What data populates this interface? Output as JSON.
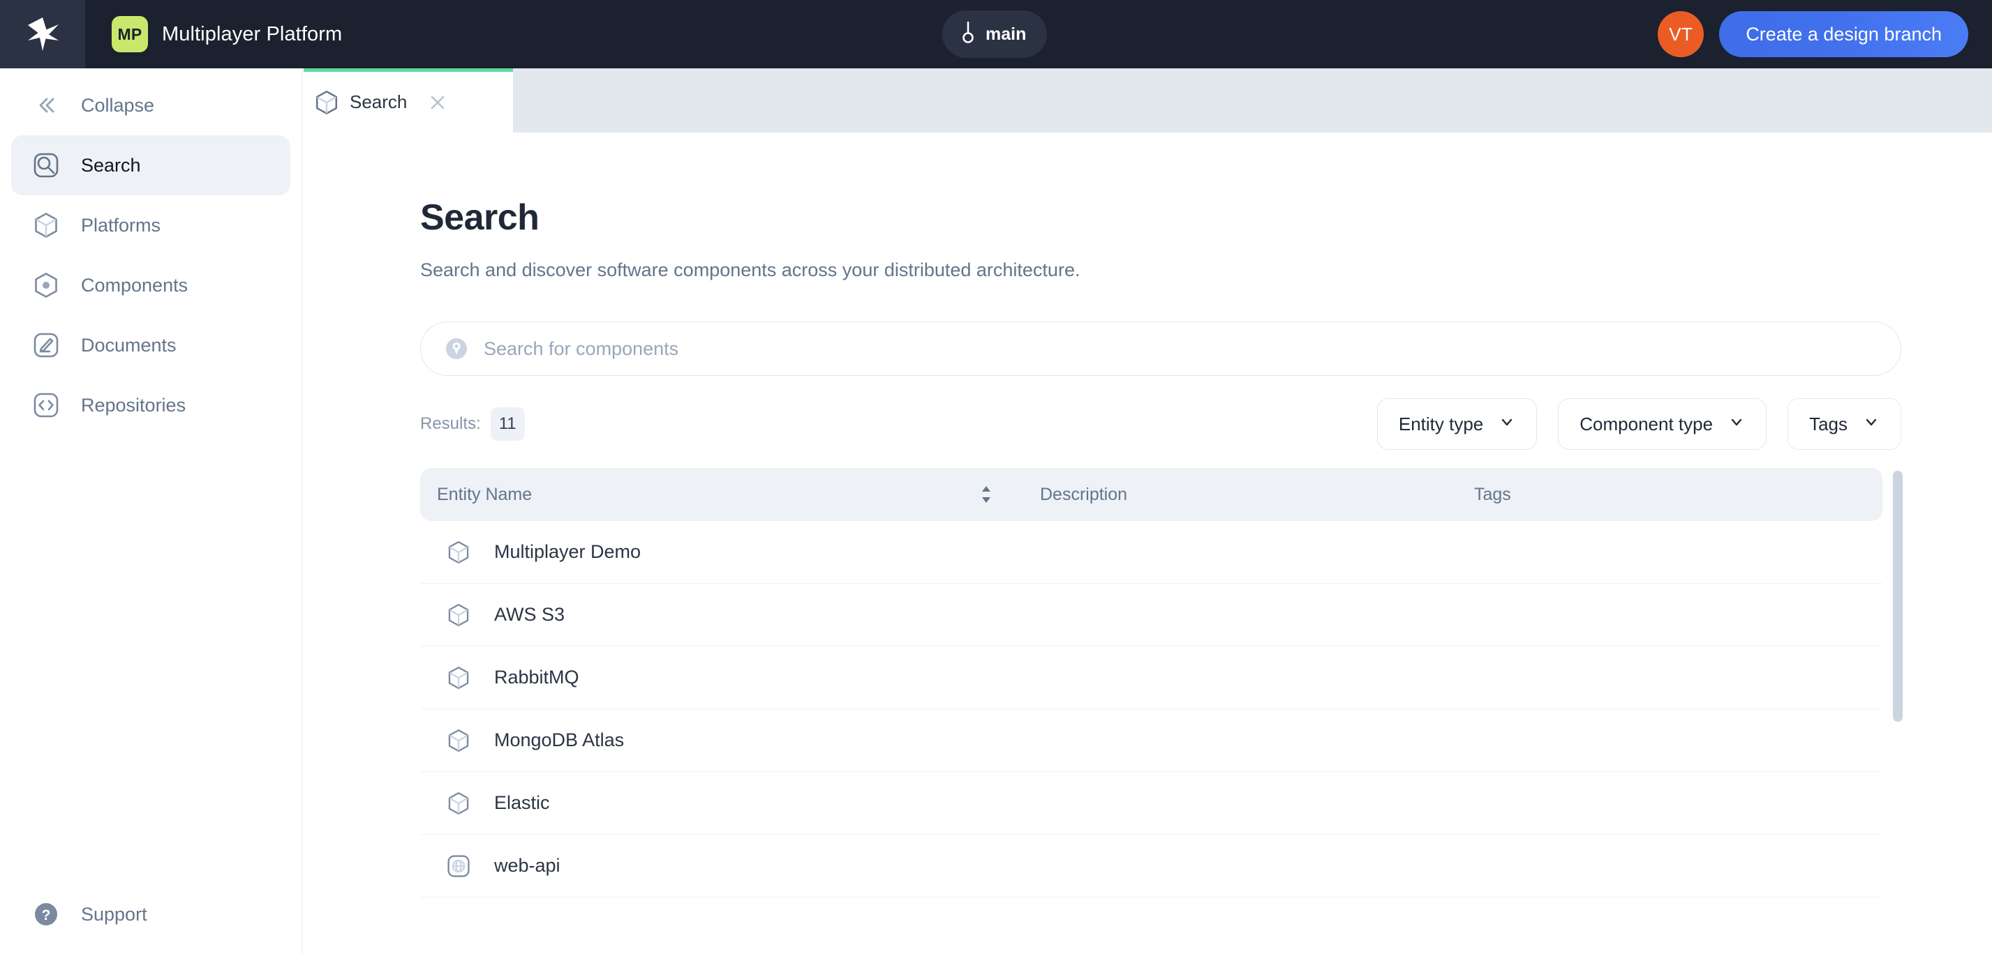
{
  "topbar": {
    "logo_icon": "star-logo-icon",
    "brand_badge": "MP",
    "brand_title": "Multiplayer Platform",
    "branch_icon": "git-branch-icon",
    "branch_name": "main",
    "avatar_initials": "VT",
    "primary_button": "Create a design branch",
    "accent_blue": "#4271ee",
    "accent_orange": "#ea5c24",
    "brand_badge_color": "#c8e86b",
    "bar_color": "#1b212e"
  },
  "sidebar": {
    "collapse": {
      "label": "Collapse",
      "icon": "chevrons-left-icon"
    },
    "items": [
      {
        "label": "Search",
        "icon": "search-square-icon",
        "active": true
      },
      {
        "label": "Platforms",
        "icon": "cube-icon",
        "active": false
      },
      {
        "label": "Components",
        "icon": "hexagon-dot-icon",
        "active": false
      },
      {
        "label": "Documents",
        "icon": "document-pen-icon",
        "active": false
      },
      {
        "label": "Repositories",
        "icon": "code-brackets-icon",
        "active": false
      }
    ],
    "support": {
      "label": "Support",
      "icon": "help-circle-icon"
    }
  },
  "tabs": [
    {
      "label": "Search",
      "icon": "cube-icon",
      "close_icon": "close-icon",
      "active": true,
      "indicator_color": "#5fd9a0"
    }
  ],
  "main": {
    "title": "Search",
    "subtitle": "Search and discover software components across your distributed architecture.",
    "search": {
      "icon": "search-pin-icon",
      "placeholder": "Search for components",
      "value": ""
    },
    "results_label": "Results:",
    "results_count": "11",
    "filters": [
      {
        "label": "Entity type",
        "icon": "chevron-down-icon"
      },
      {
        "label": "Component type",
        "icon": "chevron-down-icon"
      },
      {
        "label": "Tags",
        "icon": "chevron-down-icon"
      }
    ],
    "table": {
      "columns": [
        "Entity Name",
        "Description",
        "Tags"
      ],
      "sort_icon": "sort-updown-icon",
      "rows": [
        {
          "name": "Multiplayer Demo",
          "icon": "cube-icon",
          "description": "",
          "tags": ""
        },
        {
          "name": "AWS S3",
          "icon": "cube-icon",
          "description": "",
          "tags": ""
        },
        {
          "name": "RabbitMQ",
          "icon": "cube-icon",
          "description": "",
          "tags": ""
        },
        {
          "name": "MongoDB Atlas",
          "icon": "cube-icon",
          "description": "",
          "tags": ""
        },
        {
          "name": "Elastic",
          "icon": "cube-icon",
          "description": "",
          "tags": ""
        },
        {
          "name": "web-api",
          "icon": "globe-square-icon",
          "description": "",
          "tags": ""
        }
      ]
    }
  }
}
